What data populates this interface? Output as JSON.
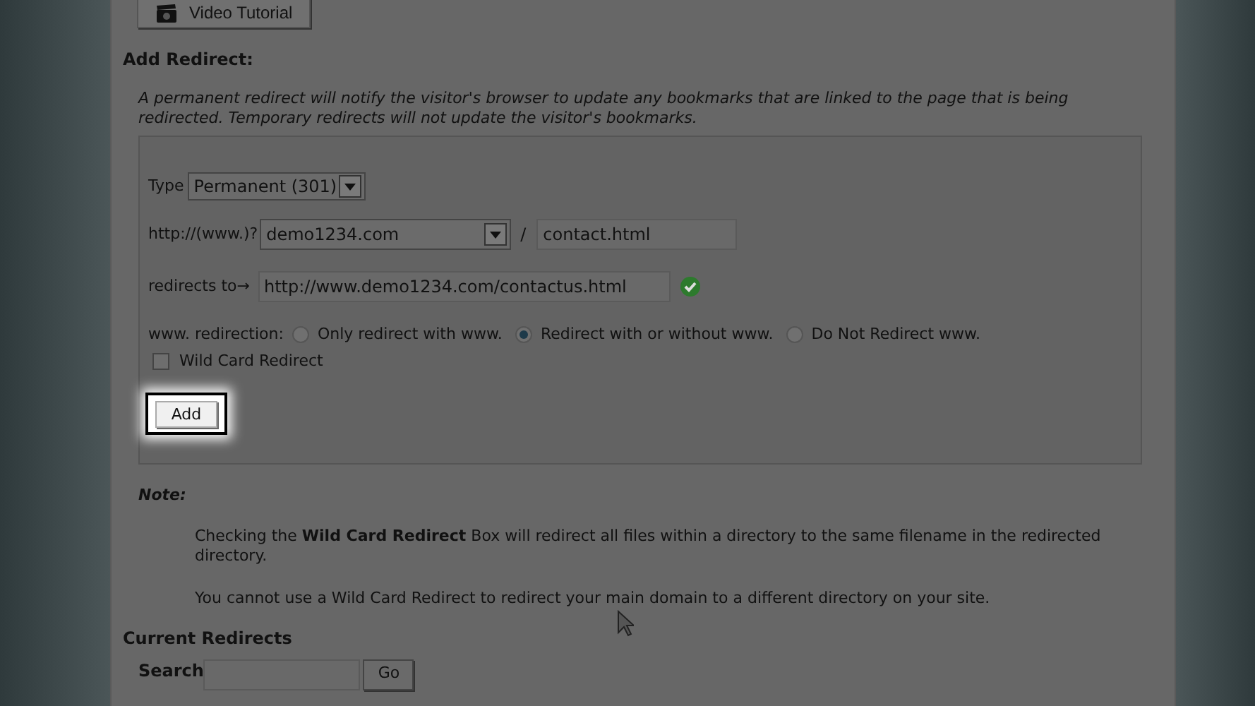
{
  "video_button": {
    "label": "Video Tutorial"
  },
  "add_redirect": {
    "heading": "Add Redirect:",
    "description": "A permanent redirect will notify the visitor's browser to update any bookmarks that are linked to the page that is being redirected. Temporary redirects will not update the visitor's bookmarks.",
    "type_label": "Type",
    "type_value": "Permanent (301)",
    "domain_label": "http://(www.)?",
    "domain_value": "demo1234.com",
    "slash": "/",
    "path_value": "contact.html",
    "redirects_label": "redirects to→",
    "redirects_value": "http://www.demo1234.com/contactus.html",
    "valid": true,
    "www_label": "www. redirection:",
    "www_options": [
      {
        "label": "Only redirect with www.",
        "selected": false
      },
      {
        "label": "Redirect with or without www.",
        "selected": true
      },
      {
        "label": "Do Not Redirect www.",
        "selected": false
      }
    ],
    "wildcard": {
      "label": "Wild Card Redirect",
      "checked": false
    },
    "add_button": {
      "label": "Add",
      "highlighted": true
    }
  },
  "note": {
    "heading": "Note:",
    "paragraphs": [
      "Checking the **Wild Card Redirect** Box will redirect all files within a directory to the same filename in the redirected directory.",
      "You cannot use a Wild Card Redirect to redirect your main domain to a different directory on your site."
    ]
  },
  "current": {
    "heading": "Current Redirects",
    "search_label": "Search",
    "go_button": "Go"
  }
}
